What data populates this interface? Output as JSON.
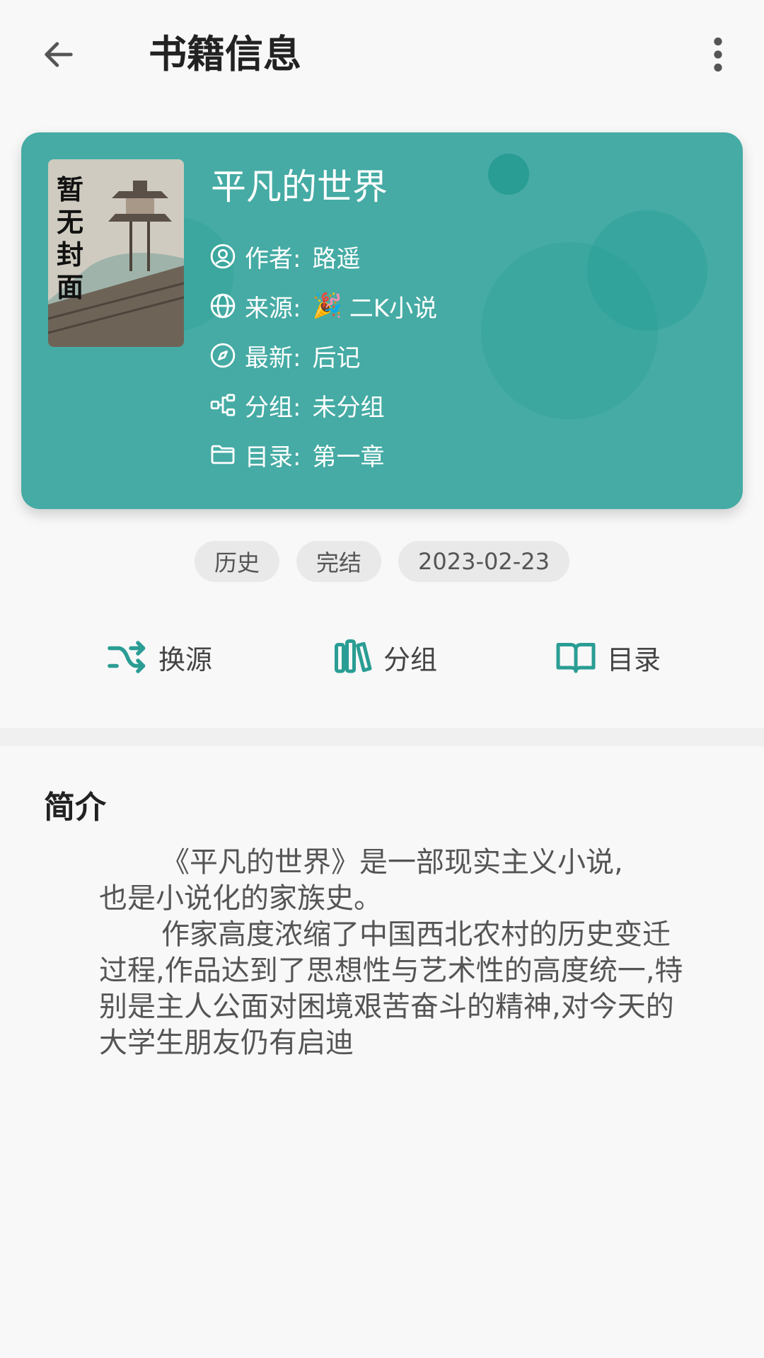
{
  "header": {
    "title": "书籍信息"
  },
  "book": {
    "cover_text": "暂无封面",
    "title": "平凡的世界",
    "author_label": "作者:",
    "author": "路遥",
    "source_label": "来源:",
    "source_emoji": "🎉",
    "source": "二K小说",
    "latest_label": "最新:",
    "latest": "后记",
    "group_label": "分组:",
    "group": "未分组",
    "toc_label": "目录:",
    "toc": "第一章"
  },
  "tags": [
    "历史",
    "完结",
    "2023-02-23"
  ],
  "actions": {
    "change_source": "换源",
    "group": "分组",
    "toc": "目录"
  },
  "intro": {
    "title": "简介",
    "para1a": "《平凡的世界》是一部现实主义小说,",
    "para1b": "也是小说化的家族史。",
    "para2": "作家高度浓缩了中国西北农村的历史变迁过程,作品达到了思想性与艺术性的高度统一,特别是主人公面对困境艰苦奋斗的精神,对今天的大学生朋友仍有启迪"
  },
  "colors": {
    "card": "#45aba4",
    "accent": "#2a9d94"
  }
}
